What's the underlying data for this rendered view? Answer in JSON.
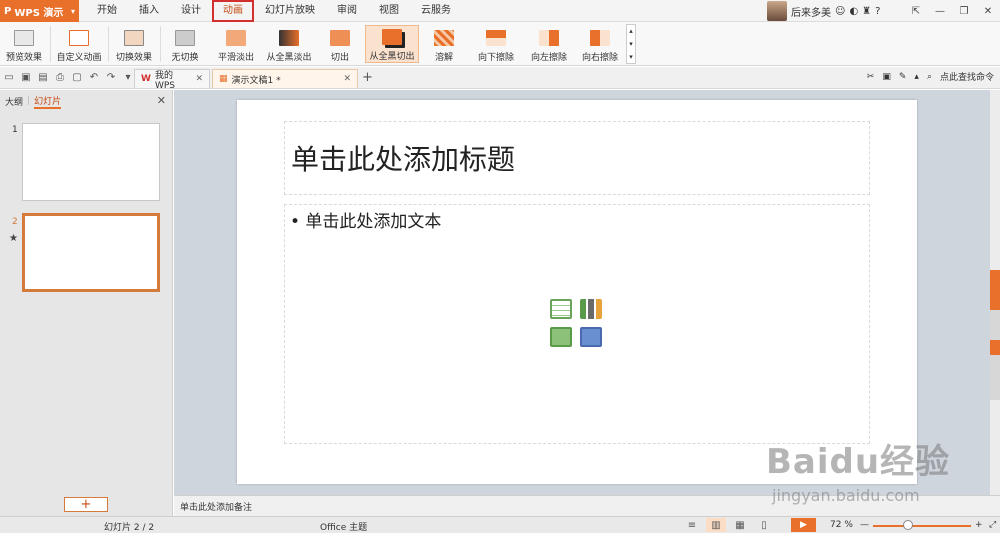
{
  "app": {
    "name": "WPS 演示"
  },
  "menu": {
    "items": [
      "开始",
      "插入",
      "设计",
      "动画",
      "幻灯片放映",
      "审阅",
      "视图",
      "云服务"
    ],
    "active": "动画"
  },
  "user": {
    "name": "后来多美"
  },
  "ribbon": {
    "preview": "预览效果",
    "custom": "自定义动画",
    "switch": "切换效果",
    "effects": [
      "无切换",
      "平滑淡出",
      "从全黑淡出",
      "切出",
      "从全黑切出",
      "溶解",
      "向下擦除",
      "向左擦除",
      "向右擦除"
    ],
    "selected_effect": "从全黑切出"
  },
  "tabs": {
    "wps": "我的WPS",
    "doc": "演示文稿1 *",
    "search": "点此查找命令"
  },
  "left_panel": {
    "outline_tab": "大纲",
    "slides_tab": "幻灯片",
    "slide_numbers": [
      "1",
      "2"
    ],
    "add_label": "+"
  },
  "slide": {
    "title_placeholder": "单击此处添加标题",
    "body_placeholder": "• 单击此处添加文本"
  },
  "notes": {
    "placeholder": "单击此处添加备注"
  },
  "status": {
    "slide_count": "幻灯片 2 / 2",
    "theme": "Office 主题",
    "zoom": "72 %"
  },
  "watermark": {
    "brand": "Baidu经验",
    "url": "jingyan.baidu.com"
  },
  "colors": {
    "accent": "#e8702a",
    "highlight_box": "#d32f2f"
  }
}
